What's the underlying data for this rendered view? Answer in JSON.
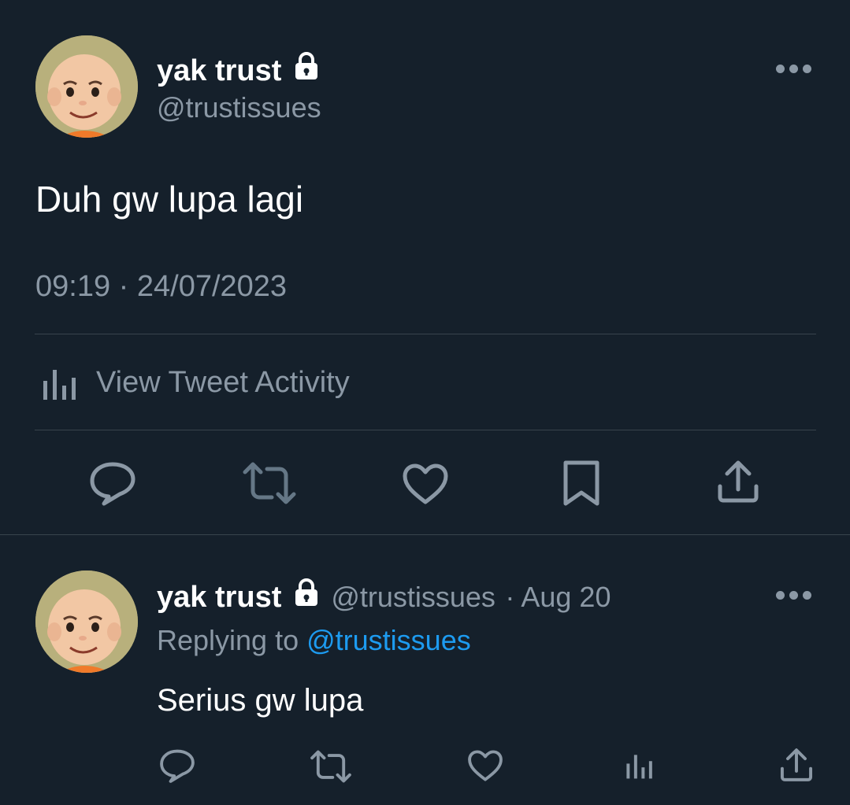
{
  "main_tweet": {
    "display_name": "yak trust",
    "handle": "@trustissues",
    "text": "Duh gw lupa lagi",
    "timestamp": "09:19 · 24/07/2023",
    "activity_label": "View Tweet Activity",
    "icons": [
      "reply-icon",
      "retweet-icon",
      "like-icon",
      "bookmark-icon",
      "share-icon"
    ]
  },
  "reply_tweet": {
    "display_name": "yak trust",
    "handle": "@trustissues",
    "date": "· Aug 20",
    "replying_prefix": "Replying to",
    "replying_handle": "@trustissues",
    "text": "Serius gw lupa",
    "icons": [
      "reply-icon",
      "retweet-icon",
      "like-icon",
      "analytics-icon",
      "share-icon"
    ]
  },
  "colors": {
    "background": "#15202b",
    "text": "#ffffff",
    "muted": "#8b98a5",
    "link": "#1d9bf0",
    "divider": "#38444d"
  }
}
